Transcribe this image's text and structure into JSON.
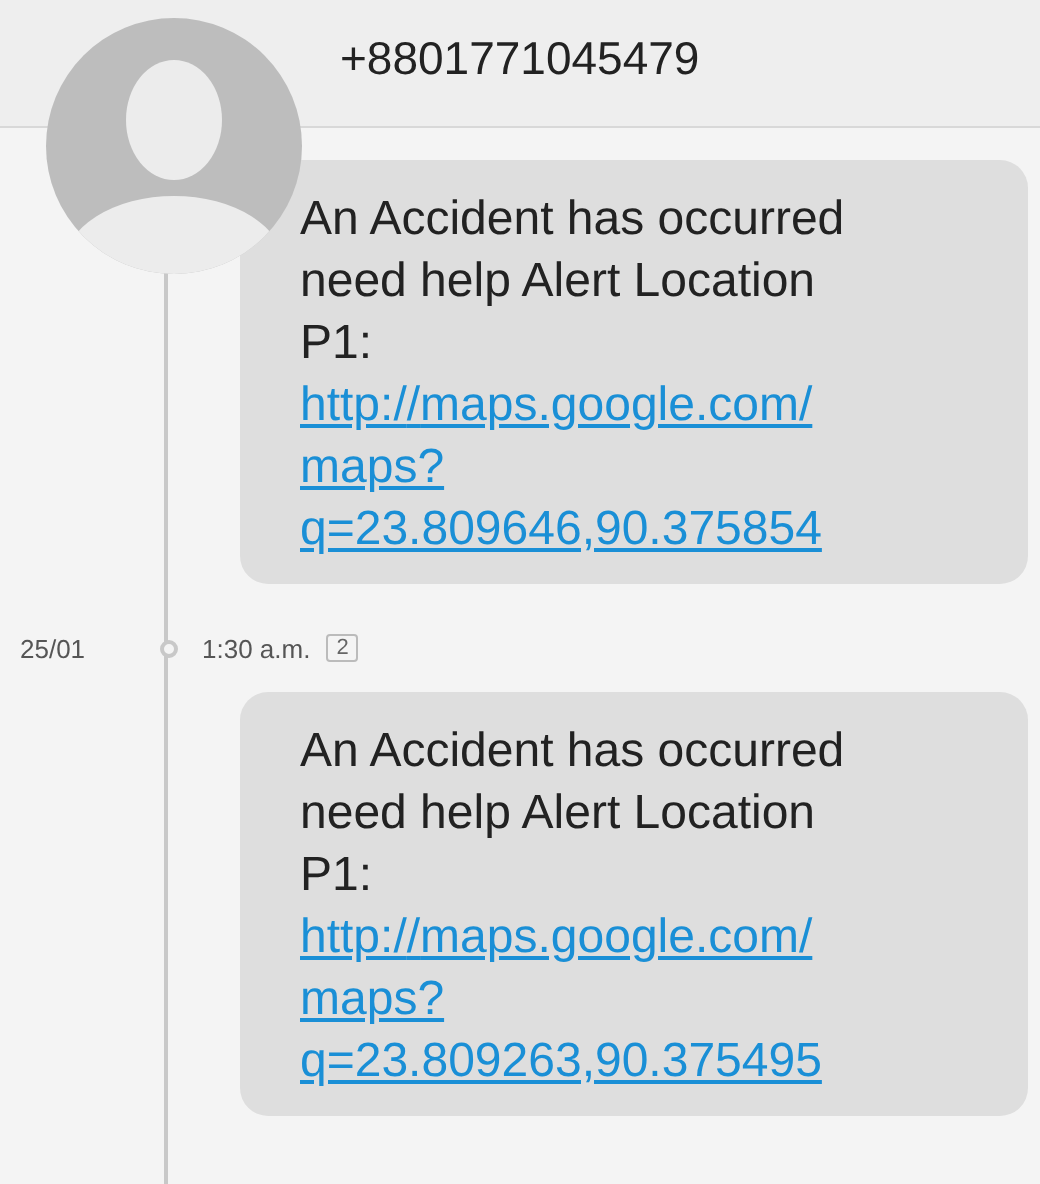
{
  "header": {
    "phone_number": "+8801771045479"
  },
  "messages": [
    {
      "text": "An Accident has occurred need help Alert Location P1:",
      "link": "http://maps.google.com/maps?q=23.809646,90.375854"
    },
    {
      "date": "25/01",
      "time": "1:30 a.m.",
      "sim": "2",
      "text": "An Accident has occurred need help Alert Location P1:",
      "link": "http://maps.google.com/maps?q=23.809263,90.375495"
    }
  ]
}
